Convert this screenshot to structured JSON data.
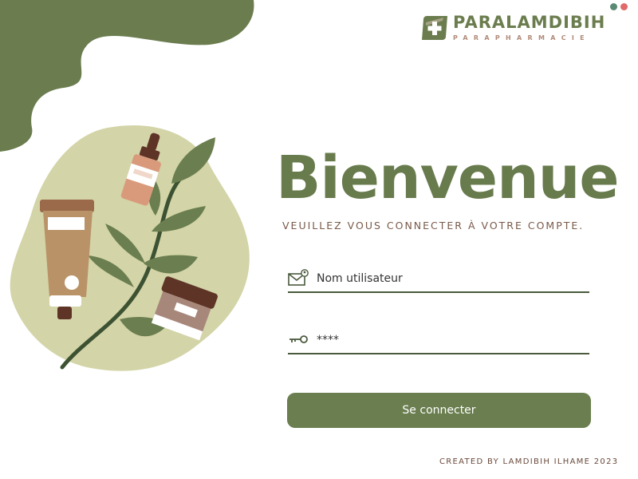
{
  "window": {
    "dot_colors": [
      "#5a8a74",
      "#e06a6a"
    ]
  },
  "logo": {
    "name": "PARALAMDIBIH",
    "subtitle": "PARAPHARMACIE",
    "icon": "pharmacy-cross-icon"
  },
  "main": {
    "title": "Bienvenue",
    "subtitle": "VEUILLEZ VOUS CONNECTER À VOTRE COMPTE."
  },
  "form": {
    "username": {
      "placeholder": "Nom utilisateur",
      "value": "",
      "icon": "mail-user-icon"
    },
    "password": {
      "placeholder": "",
      "value": "****",
      "icon": "key-icon"
    },
    "submit_label": "Se connecter"
  },
  "footer": {
    "credit": "CREATED BY LAMDIBIH ILHAME 2023"
  },
  "colors": {
    "primary": "#6a7e4f",
    "blob_light": "#d3d4a7",
    "accent_brown": "#7a5a49"
  }
}
